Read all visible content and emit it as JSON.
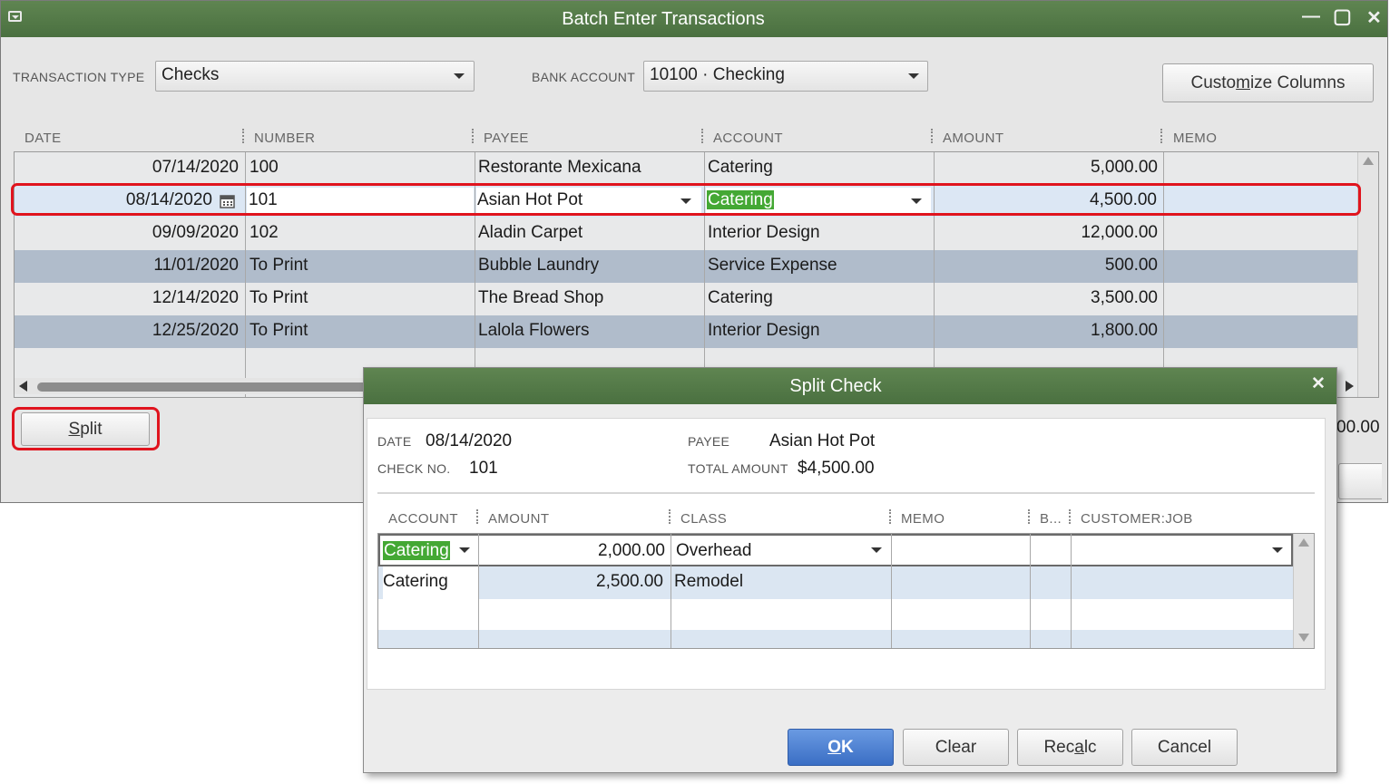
{
  "main_window": {
    "title": "Batch Enter Transactions",
    "controls": {
      "minimize": "—",
      "maximize": "▢",
      "close": "✕"
    }
  },
  "transaction_type": {
    "label": "TRANSACTION TYPE",
    "value": "Checks"
  },
  "bank_account": {
    "label": "BANK ACCOUNT",
    "value": "10100 · Checking"
  },
  "customize_columns": {
    "pre": "Custo",
    "u": "m",
    "post": "ize Columns"
  },
  "columns": [
    "DATE",
    "NUMBER",
    "PAYEE",
    "ACCOUNT",
    "AMOUNT",
    "MEMO"
  ],
  "rows": [
    {
      "date": "07/14/2020",
      "number": "100",
      "payee": "Restorante Mexicana",
      "account": "Catering",
      "amount": "5,000.00",
      "memo": ""
    },
    {
      "date": "08/14/2020",
      "number": "101",
      "payee": "Asian Hot Pot",
      "account": "Catering",
      "amount": "4,500.00",
      "memo": ""
    },
    {
      "date": "09/09/2020",
      "number": "102",
      "payee": "Aladin Carpet",
      "account": "Interior Design",
      "amount": "12,000.00",
      "memo": ""
    },
    {
      "date": "11/01/2020",
      "number": "To Print",
      "payee": "Bubble Laundry",
      "account": "Service Expense",
      "amount": "500.00",
      "memo": ""
    },
    {
      "date": "12/14/2020",
      "number": "To Print",
      "payee": "The Bread Shop",
      "account": "Catering",
      "amount": "3,500.00",
      "memo": ""
    },
    {
      "date": "12/25/2020",
      "number": "To Print",
      "payee": "Lalola Flowers",
      "account": "Interior Design",
      "amount": "1,800.00",
      "memo": ""
    }
  ],
  "split_button": {
    "u": "S",
    "post": "plit"
  },
  "partial_total": "00.00",
  "split_dialog": {
    "title": "Split Check",
    "close": "✕",
    "date_label": "DATE",
    "date": "08/14/2020",
    "check_no_label": "CHECK NO.",
    "check_no": "101",
    "payee_label": "PAYEE",
    "payee": "Asian Hot Pot",
    "total_label": "TOTAL AMOUNT",
    "total": "$4,500.00",
    "columns": [
      "ACCOUNT",
      "AMOUNT",
      "CLASS",
      "MEMO",
      "B...",
      "CUSTOMER:JOB"
    ],
    "lines": [
      {
        "account": "Catering",
        "amount": "2,000.00",
        "class": "Overhead",
        "memo": "",
        "billable": "",
        "customer_job": ""
      },
      {
        "account": "Catering",
        "amount": "2,500.00",
        "class": "Remodel",
        "memo": "",
        "billable": "",
        "customer_job": ""
      }
    ],
    "buttons": {
      "ok": {
        "pre": "",
        "u": "O",
        "post": "K"
      },
      "clear": "Clear",
      "recalc": {
        "pre": "Rec",
        "u": "a",
        "post": "lc"
      },
      "cancel": "Cancel"
    }
  }
}
